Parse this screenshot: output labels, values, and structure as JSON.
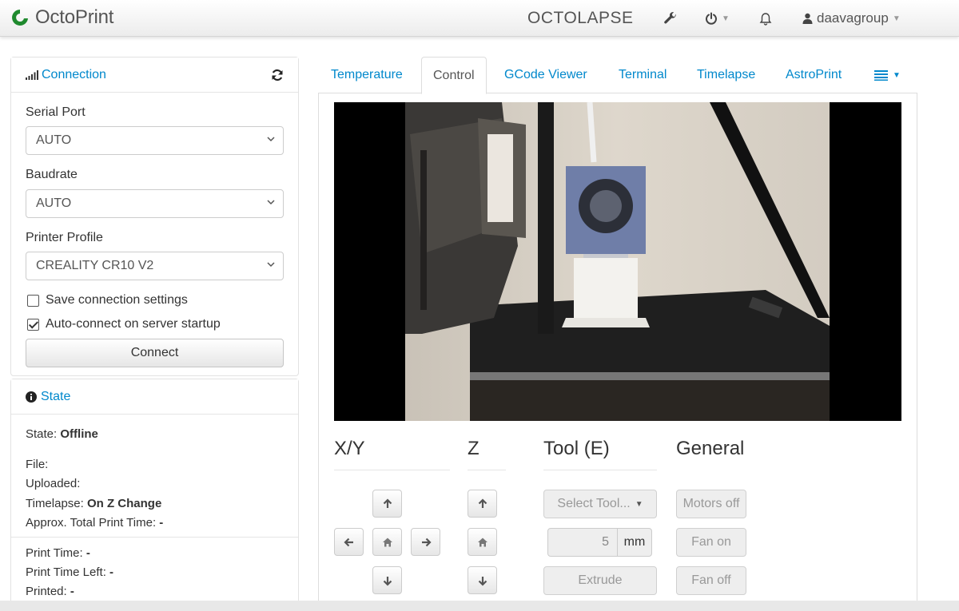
{
  "navbar": {
    "brand": "OctoPrint",
    "title": "OCTOLAPSE",
    "user": "daavagroup"
  },
  "connection": {
    "heading": "Connection",
    "serial_port_label": "Serial Port",
    "serial_port_value": "AUTO",
    "baudrate_label": "Baudrate",
    "baudrate_value": "AUTO",
    "profile_label": "Printer Profile",
    "profile_value": "CREALITY CR10 V2",
    "save_settings_label": "Save connection settings",
    "save_settings_checked": false,
    "autoconnect_label": "Auto-connect on server startup",
    "autoconnect_checked": true,
    "connect_button": "Connect"
  },
  "state": {
    "heading": "State",
    "state_label": "State:",
    "state_value": "Offline",
    "file_label": "File:",
    "uploaded_label": "Uploaded:",
    "timelapse_label": "Timelapse:",
    "timelapse_value": "On Z Change",
    "approx_label": "Approx. Total Print Time:",
    "approx_value": "-",
    "print_time_label": "Print Time:",
    "print_time_value": "-",
    "time_left_label": "Print Time Left:",
    "time_left_value": "-",
    "printed_label": "Printed:",
    "printed_value": "-"
  },
  "tabs": [
    {
      "label": "Temperature"
    },
    {
      "label": "Control"
    },
    {
      "label": "GCode Viewer"
    },
    {
      "label": "Terminal"
    },
    {
      "label": "Timelapse"
    },
    {
      "label": "AstroPrint"
    }
  ],
  "control": {
    "xy_title": "X/Y",
    "z_title": "Z",
    "tool_title": "Tool (E)",
    "general_title": "General",
    "select_tool": "Select Tool...",
    "extrude_amount": "5",
    "extrude_unit": "mm",
    "extrude_button": "Extrude",
    "motors_off": "Motors off",
    "fan_on": "Fan on",
    "fan_off": "Fan off"
  },
  "colors": {
    "link": "#0088cc",
    "brand_green": "#1f8a2e"
  },
  "icons": [
    "octoprint-logo-icon",
    "wrench-icon",
    "power-icon",
    "bell-icon",
    "user-icon",
    "signal-icon",
    "refresh-icon",
    "info-icon",
    "hamburger-icon",
    "arrow-up-icon",
    "arrow-down-icon",
    "arrow-left-icon",
    "arrow-right-icon",
    "home-icon"
  ]
}
